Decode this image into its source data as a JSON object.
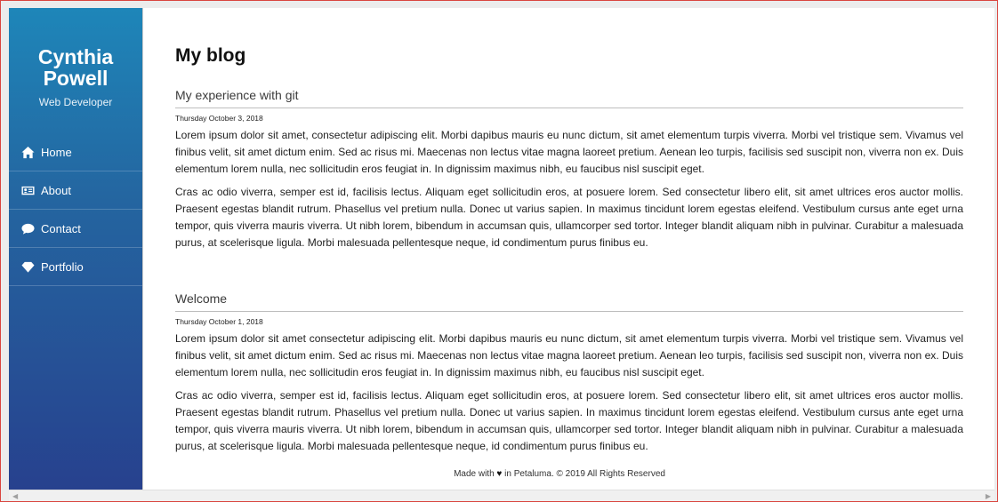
{
  "sidebar": {
    "name_line1": "Cynthia",
    "name_line2": "Powell",
    "role": "Web Developer",
    "items": [
      {
        "label": "Home",
        "icon": "home-icon"
      },
      {
        "label": "About",
        "icon": "id-card-icon"
      },
      {
        "label": "Contact",
        "icon": "chat-bubble-icon"
      },
      {
        "label": "Portfolio",
        "icon": "diamond-icon"
      }
    ]
  },
  "main": {
    "page_title": "My blog",
    "posts": [
      {
        "title": "My experience with git",
        "date": "Thursday October 3, 2018",
        "paragraphs": [
          "Lorem ipsum dolor sit amet, consectetur adipiscing elit. Morbi dapibus mauris eu nunc dictum, sit amet elementum turpis viverra. Morbi vel tristique sem. Vivamus vel finibus velit, sit amet dictum enim. Sed ac risus mi. Maecenas non lectus vitae magna laoreet pretium. Aenean leo turpis, facilisis sed suscipit non, viverra non ex. Duis elementum lorem nulla, nec sollicitudin eros feugiat in. In dignissim maximus nibh, eu faucibus nisl suscipit eget.",
          "Cras ac odio viverra, semper est id, facilisis lectus. Aliquam eget sollicitudin eros, at posuere lorem. Sed consectetur libero elit, sit amet ultrices eros auctor mollis. Praesent egestas blandit rutrum. Phasellus vel pretium nulla. Donec ut varius sapien. In maximus tincidunt lorem egestas eleifend. Vestibulum cursus ante eget urna tempor, quis viverra mauris viverra. Ut nibh lorem, bibendum in accumsan quis, ullamcorper sed tortor. Integer blandit aliquam nibh in pulvinar. Curabitur a malesuada purus, at scelerisque ligula. Morbi malesuada pellentesque neque, id condimentum purus finibus eu."
        ]
      },
      {
        "title": "Welcome",
        "date": "Thursday October 1, 2018",
        "paragraphs": [
          "Lorem ipsum dolor sit amet consectetur adipiscing elit. Morbi dapibus mauris eu nunc dictum, sit amet elementum turpis viverra. Morbi vel tristique sem. Vivamus vel finibus velit, sit amet dictum enim. Sed ac risus mi. Maecenas non lectus vitae magna laoreet pretium. Aenean leo turpis, facilisis sed suscipit non, viverra non ex. Duis elementum lorem nulla, nec sollicitudin eros feugiat in. In dignissim maximus nibh, eu faucibus nisl suscipit eget.",
          "Cras ac odio viverra, semper est id, facilisis lectus. Aliquam eget sollicitudin eros, at posuere lorem. Sed consectetur libero elit, sit amet ultrices eros auctor mollis. Praesent egestas blandit rutrum. Phasellus vel pretium nulla. Donec ut varius sapien. In maximus tincidunt lorem egestas eleifend. Vestibulum cursus ante eget urna tempor, quis viverra mauris viverra. Ut nibh lorem, bibendum in accumsan quis, ullamcorper sed tortor. Integer blandit aliquam nibh in pulvinar. Curabitur a malesuada purus, at scelerisque ligula. Morbi malesuada pellentesque neque, id condimentum purus finibus eu."
        ]
      }
    ]
  },
  "footer": {
    "before": "Made with",
    "heart": "♥",
    "after": "in Petaluma. © 2019 All Rights Reserved"
  },
  "colors": {
    "sidebar_top": "#1e86b9",
    "sidebar_bottom": "#27418e"
  }
}
